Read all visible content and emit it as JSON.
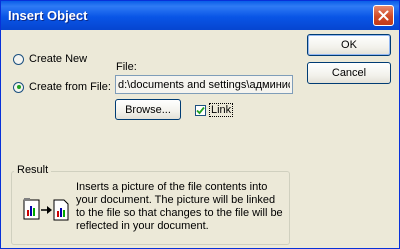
{
  "window": {
    "title": "Insert Object"
  },
  "options": {
    "create_new_label": "Create New",
    "create_from_file_label": "Create from File:",
    "selected": "create_from_file"
  },
  "file": {
    "label": "File:",
    "value": "d:\\documents and settings\\администра"
  },
  "buttons": {
    "ok_label": "OK",
    "cancel_label": "Cancel",
    "browse_label": "Browse...",
    "link_label": "Link",
    "link_checked": true
  },
  "result": {
    "legend": "Result",
    "text": "Inserts a picture of the file contents into your document. The picture will be linked to the file so that changes to the file will be reflected in your document.",
    "icon": "linked-file-icon"
  },
  "colors": {
    "titlebar": "#0a5ee8",
    "dialog_bg": "#ece9d8",
    "close_button": "#d04a26",
    "button_border": "#003c74",
    "checkmark": "#21a121"
  }
}
